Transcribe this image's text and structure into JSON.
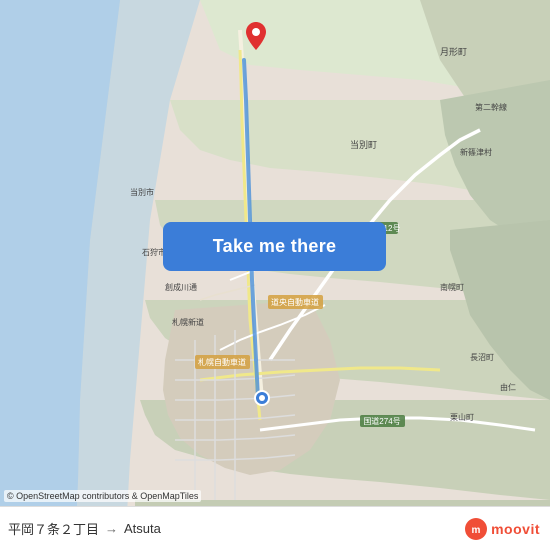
{
  "map": {
    "attribution": "© OpenStreetMap contributors & OpenMapTiles",
    "backgroundColor": "#e8e0d8"
  },
  "button": {
    "label": "Take me there"
  },
  "bottom_bar": {
    "origin": "平岡７条２丁目",
    "arrow": "→",
    "destination": "Atsuta"
  },
  "moovit": {
    "icon_letter": "m",
    "text": "moovit"
  },
  "pins": {
    "destination_color": "#e03030",
    "origin_color": "#3b7dd8"
  }
}
